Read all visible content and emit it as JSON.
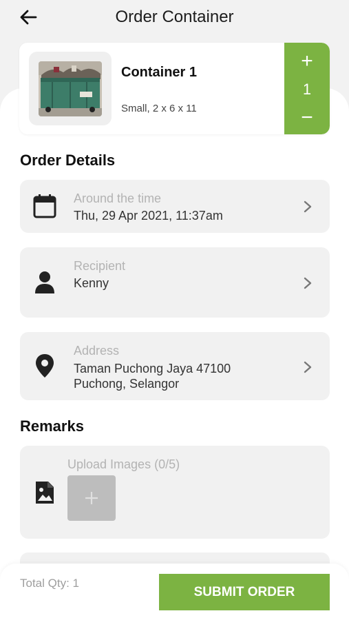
{
  "header": {
    "title": "Order Container",
    "back_icon": "arrow-left-icon"
  },
  "container": {
    "name": "Container 1",
    "spec": "Small, 2 x 6 x 11",
    "image": "dumpster-photo",
    "quantity": "1",
    "plus": "+",
    "minus": "−"
  },
  "order_details": {
    "title": "Order Details",
    "time": {
      "label": "Around the time",
      "value": "Thu, 29 Apr 2021, 11:37am",
      "icon": "calendar-icon"
    },
    "recipient": {
      "label": "Recipient",
      "value": "Kenny",
      "icon": "person-icon"
    },
    "address": {
      "label": "Address",
      "line1": "Taman Puchong Jaya  47100",
      "line2": "Puchong, Selangor",
      "icon": "location-pin-icon"
    }
  },
  "remarks": {
    "title": "Remarks",
    "upload_label": "Upload Images (0/5)",
    "icon": "image-file-icon"
  },
  "footer": {
    "total_qty": "Total Qty: 1",
    "submit_label": "SUBMIT ORDER"
  },
  "colors": {
    "accent": "#7cb342",
    "card_bg": "#f1f1f1",
    "page_bg": "#f2f2f2"
  }
}
